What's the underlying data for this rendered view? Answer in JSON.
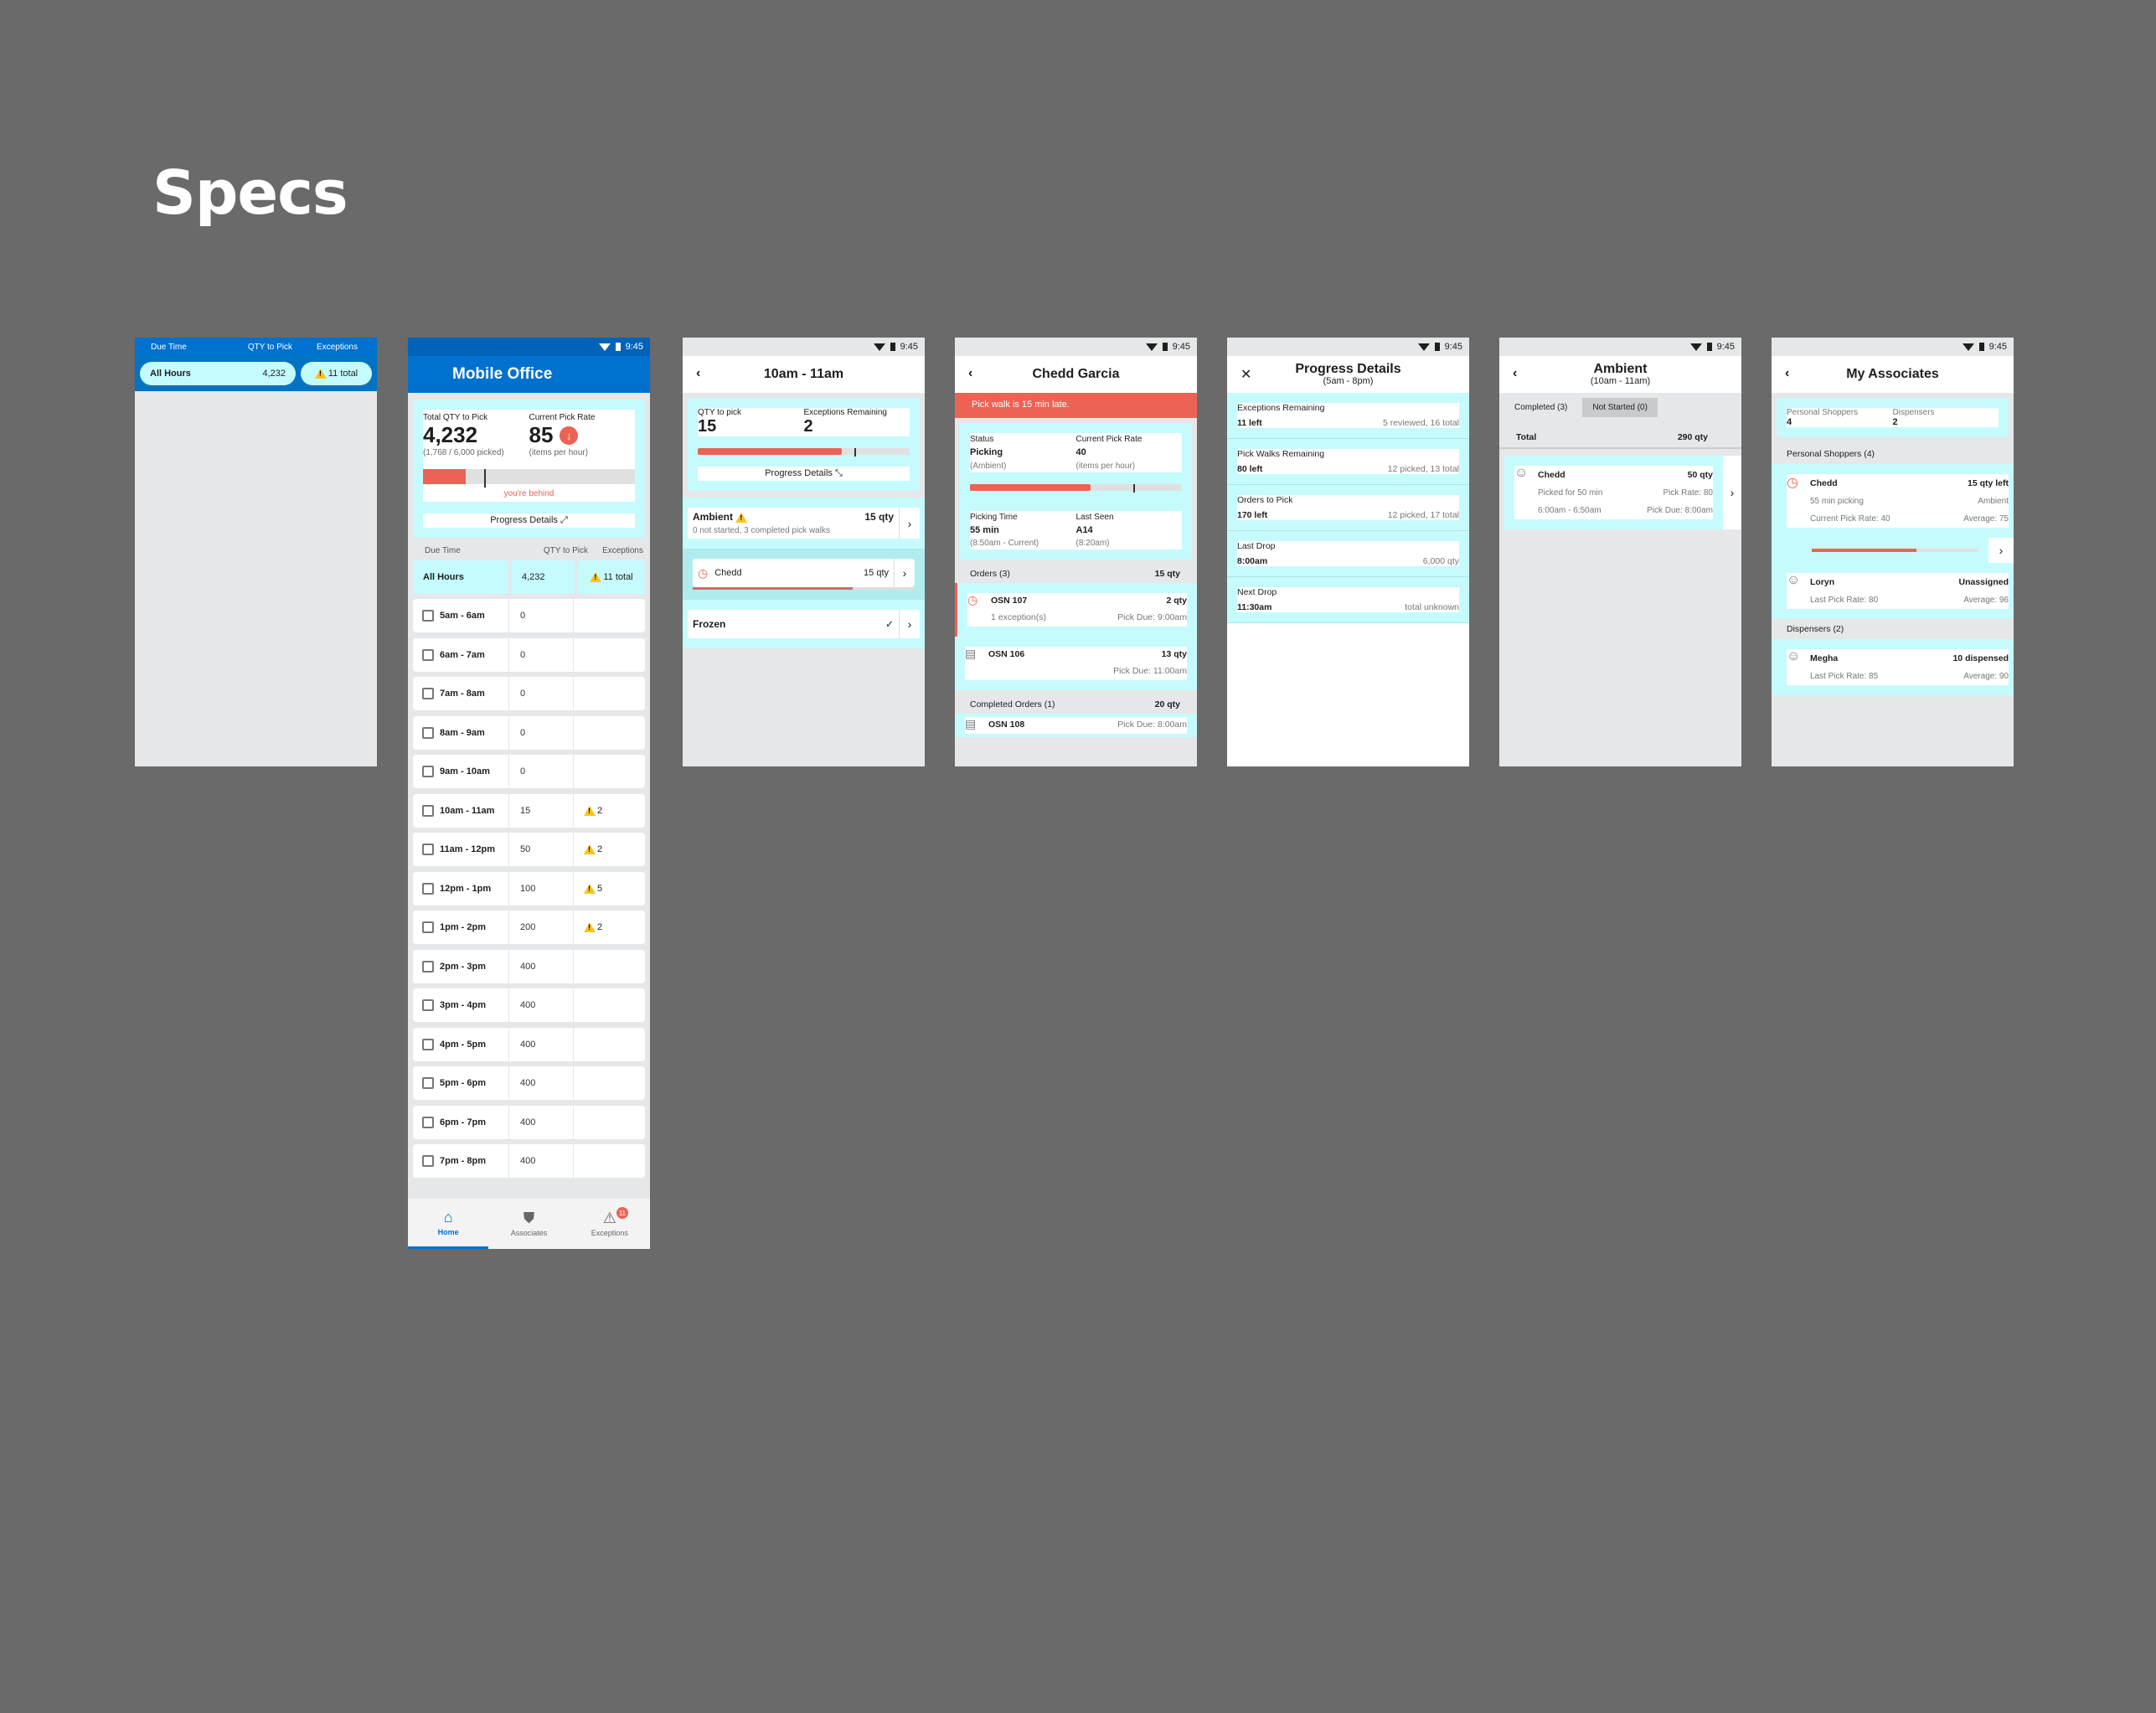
{
  "page_title": "Specs",
  "status_bar": {
    "time": "9:45"
  },
  "screen1": {
    "headers": {
      "due_time": "Due Time",
      "qty_to_pick": "QTY to Pick",
      "exceptions": "Exceptions"
    },
    "all_hours": {
      "label": "All Hours",
      "qty": "4,232",
      "exceptions": "11 total"
    }
  },
  "screen2": {
    "app_title": "Mobile Office",
    "summary": {
      "total_label": "Total QTY to Pick",
      "total_value": "4,232",
      "total_sub": "(1,768 / 6,000 picked)",
      "rate_label": "Current Pick Rate",
      "rate_value": "85",
      "rate_sub": "(items per hour)",
      "progress_fraction": 0.2,
      "target_fraction": 0.29,
      "behind_text": "you're behind",
      "progress_details_label": "Progress Details"
    },
    "table_headers": {
      "due_time": "Due Time",
      "qty_to_pick": "QTY to Pick",
      "exceptions": "Exceptions"
    },
    "all_hours": {
      "label": "All Hours",
      "qty": "4,232",
      "exceptions": "11 total"
    },
    "hours": [
      {
        "label": "5am - 6am",
        "qty": "0",
        "exceptions": ""
      },
      {
        "label": "6am - 7am",
        "qty": "0",
        "exceptions": ""
      },
      {
        "label": "7am - 8am",
        "qty": "0",
        "exceptions": ""
      },
      {
        "label": "8am - 9am",
        "qty": "0",
        "exceptions": ""
      },
      {
        "label": "9am - 10am",
        "qty": "0",
        "exceptions": ""
      },
      {
        "label": "10am - 11am",
        "qty": "15",
        "exceptions": "2"
      },
      {
        "label": "11am - 12pm",
        "qty": "50",
        "exceptions": "2"
      },
      {
        "label": "12pm - 1pm",
        "qty": "100",
        "exceptions": "5"
      },
      {
        "label": "1pm - 2pm",
        "qty": "200",
        "exceptions": "2"
      },
      {
        "label": "2pm - 3pm",
        "qty": "400",
        "exceptions": ""
      },
      {
        "label": "3pm - 4pm",
        "qty": "400",
        "exceptions": ""
      },
      {
        "label": "4pm - 5pm",
        "qty": "400",
        "exceptions": ""
      },
      {
        "label": "5pm - 6pm",
        "qty": "400",
        "exceptions": ""
      },
      {
        "label": "6pm - 7pm",
        "qty": "400",
        "exceptions": ""
      },
      {
        "label": "7pm - 8pm",
        "qty": "400",
        "exceptions": ""
      }
    ],
    "bottom_nav": {
      "home": "Home",
      "associates": "Associates",
      "exceptions": "Exceptions",
      "exceptions_badge": "11"
    }
  },
  "screen3": {
    "title": "10am - 11am",
    "qty_label": "QTY to pick",
    "qty_value": "15",
    "exc_label": "Exceptions Remaining",
    "exc_value": "2",
    "progress_fraction": 0.68,
    "target_fraction": 0.74,
    "progress_details_label": "Progress Details",
    "ambient": {
      "name": "Ambient",
      "qty": "15 qty",
      "sub": "0 not started, 3 completed pick walks"
    },
    "associate": {
      "name": "Chedd",
      "qty": "15 qty",
      "progress_fraction": 0.72
    },
    "frozen": {
      "name": "Frozen"
    }
  },
  "screen4": {
    "title": "Chedd Garcia",
    "alert": "Pick walk is 15 min late.",
    "status_label": "Status",
    "status_value": "Picking",
    "status_sub": "(Ambient)",
    "rate_label": "Current Pick Rate",
    "rate_value": "40",
    "rate_sub": "(items per hour)",
    "progress_fraction": 0.57,
    "target_fraction": 0.77,
    "time_label": "Picking Time",
    "time_value": "55 min",
    "time_sub": "(8:50am - Current)",
    "seen_label": "Last Seen",
    "seen_value": "A14",
    "seen_sub": "(8:20am)",
    "orders_header": {
      "label": "Orders (3)",
      "qty": "15 qty"
    },
    "orders": [
      {
        "name": "OSN 107",
        "qty": "2 qty",
        "sub": "1 exception(s)",
        "due": "Pick Due: 9:00am",
        "late": true
      },
      {
        "name": "OSN 106",
        "qty": "13 qty",
        "sub": "",
        "due": "Pick Due: 11:00am",
        "late": false
      }
    ],
    "completed_header": {
      "label": "Completed Orders (1)",
      "qty": "20 qty"
    },
    "completed": [
      {
        "name": "OSN 108",
        "due": "Pick Due: 8:00am"
      }
    ]
  },
  "screen5": {
    "title": "Progress Details",
    "subtitle": "(5am - 8pm)",
    "items": [
      {
        "label": "Exceptions Remaining",
        "value": "11 left",
        "detail": "5 reviewed, 16 total"
      },
      {
        "label": "Pick Walks Remaining",
        "value": "80 left",
        "detail": "12 picked, 13 total"
      },
      {
        "label": "Orders to Pick",
        "value": "170 left",
        "detail": "12 picked, 17 total"
      },
      {
        "label": "Last Drop",
        "value": "8:00am",
        "detail": "6,000 qty"
      },
      {
        "label": "Next Drop",
        "value": "11:30am",
        "detail": "total unknown"
      }
    ]
  },
  "screen6": {
    "title": "Ambient",
    "subtitle": "(10am - 11am)",
    "tabs": [
      "Completed (3)",
      "Not Started (0)"
    ],
    "total": {
      "label": "Total",
      "qty": "290 qty"
    },
    "associate": {
      "name": "Chedd",
      "qty": "50 qty",
      "picked_for": "Picked for 50 min",
      "pick_rate": "Pick Rate: 80",
      "time_range": "6:00am - 6:50am",
      "due": "Pick Due: 8:00am"
    }
  },
  "screen7": {
    "title": "My Associates",
    "counts": {
      "shoppers_label": "Personal Shoppers",
      "shoppers_value": "4",
      "dispensers_label": "Dispensers",
      "dispensers_value": "2"
    },
    "shoppers_header": "Personal Shoppers (4)",
    "shoppers": [
      {
        "name": "Chedd",
        "status": "15 qty left",
        "line2_left": "55 min picking",
        "line2_right": "Ambient",
        "line3_left": "Current Pick Rate: 40",
        "line3_right": "Average: 75",
        "progress_fraction": 0.63,
        "active": true
      },
      {
        "name": "Loryn",
        "status": "Unassigned",
        "line2_left": "Last Pick Rate: 80",
        "line2_right": "Average: 96",
        "active": false
      }
    ],
    "dispensers_header": "Dispensers (2)",
    "dispensers": [
      {
        "name": "Megha",
        "status": "10 dispensed",
        "line2_left": "Last Pick Rate: 85",
        "line2_right": "Average: 90"
      }
    ]
  }
}
